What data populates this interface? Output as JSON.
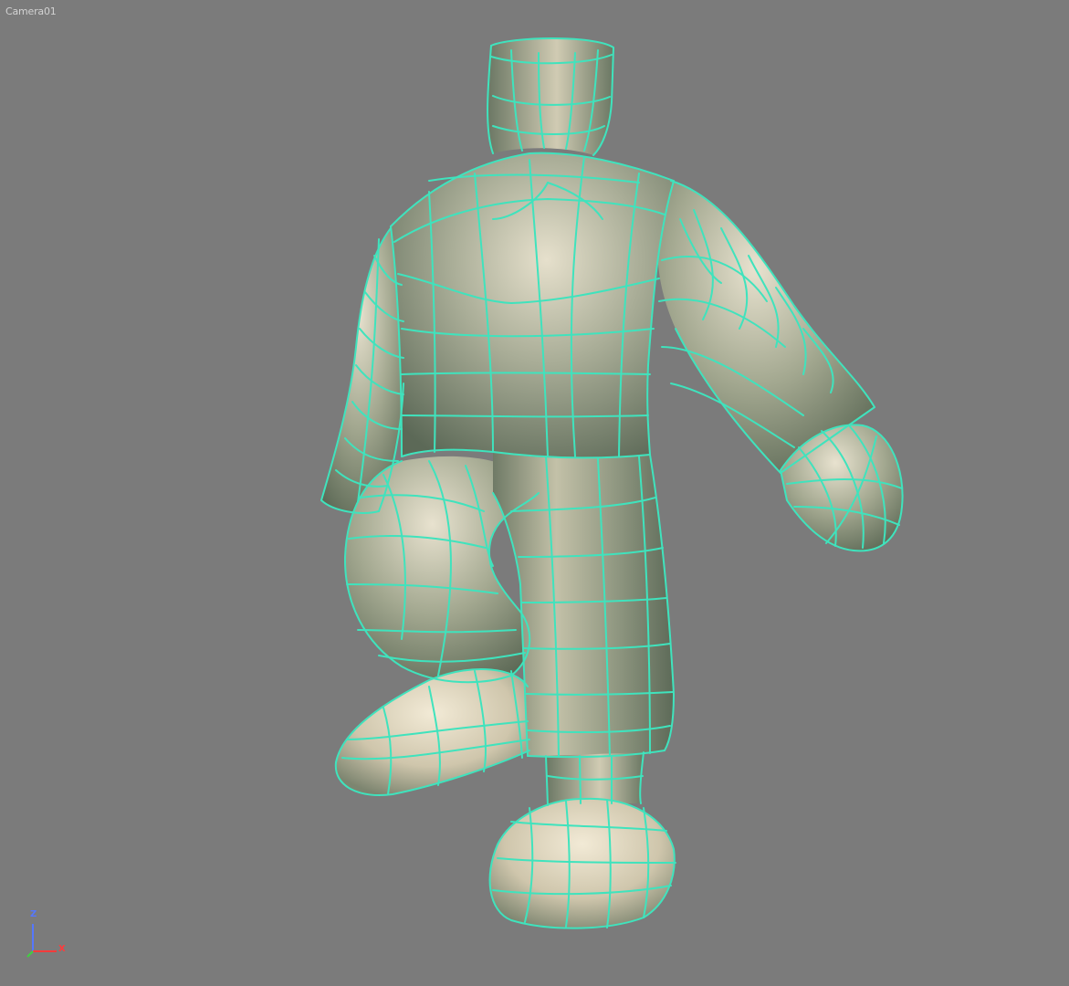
{
  "viewport": {
    "label": "Camera01",
    "background_color": "#7b7b7b"
  },
  "model": {
    "surface_color": "#c8c4b0",
    "wireframe_color": "#3fe3bd"
  },
  "axis_gizmo": {
    "z_label": "Z",
    "x_label": "X",
    "z_color": "#5577ff",
    "x_color": "#ff3b3b",
    "origin_color": "#40d040"
  }
}
